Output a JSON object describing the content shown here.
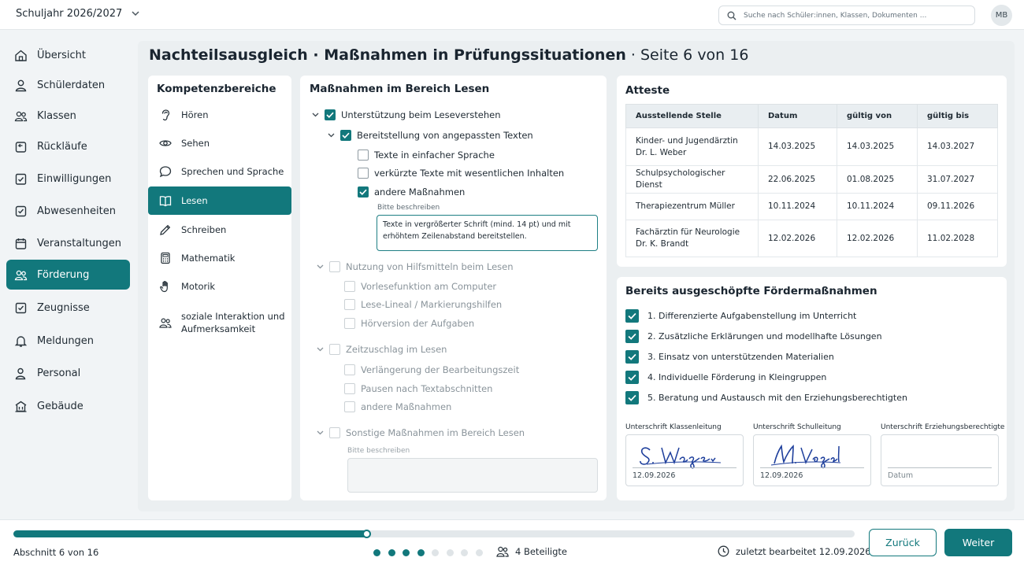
{
  "header": {
    "school_year": "Schuljahr 2026/2027",
    "search_placeholder": "Suche nach Schüler:innen, Klassen, Dokumenten ...",
    "avatar": "MB"
  },
  "sidebar": {
    "items": [
      {
        "label": "Übersicht",
        "icon": "home-icon"
      },
      {
        "label": "Schülerdaten",
        "icon": "user-icon"
      },
      {
        "label": "Klassen",
        "icon": "users-icon"
      },
      {
        "label": "Rückläufe",
        "icon": "return-icon"
      },
      {
        "label": "Einwilligungen",
        "icon": "consent-icon"
      },
      {
        "label": "Abwesenheiten",
        "icon": "absence-icon"
      },
      {
        "label": "Veranstaltungen",
        "icon": "calendar-icon"
      },
      {
        "label": "Förderung",
        "icon": "support-icon",
        "active": true
      },
      {
        "label": "Zeugnisse",
        "icon": "certificate-icon"
      },
      {
        "label": "Meldungen",
        "icon": "bell-icon"
      },
      {
        "label": "Personal",
        "icon": "staff-icon"
      },
      {
        "label": "Gebäude",
        "icon": "building-icon"
      }
    ]
  },
  "page": {
    "title": "Nachteilsausgleich · Maßnahmen in Prüfungssituationen",
    "page_info": " · Seite 6 von 16"
  },
  "competences": {
    "title": "Kompetenzbereiche",
    "items": [
      {
        "label": "Hören",
        "icon": "ear-icon"
      },
      {
        "label": "Sehen",
        "icon": "eye-icon"
      },
      {
        "label": "Sprechen und Sprache",
        "icon": "speech-icon"
      },
      {
        "label": "Lesen",
        "icon": "book-icon",
        "active": true
      },
      {
        "label": "Schreiben",
        "icon": "pencil-icon"
      },
      {
        "label": "Mathematik",
        "icon": "calculator-icon"
      },
      {
        "label": "Motorik",
        "icon": "hand-icon"
      },
      {
        "label": "soziale Interaktion und Aufmerksamkeit",
        "line1": "soziale Interaktion und",
        "line2": "Aufmerksamkeit",
        "icon": "group-icon"
      }
    ]
  },
  "measures": {
    "title": "Maßnahmen im Bereich Lesen",
    "group1": {
      "label": "Unterstützung beim Leseverstehen",
      "checked": true,
      "sub": {
        "label": "Bereitstellung von angepassten Texten",
        "checked": true,
        "options": [
          {
            "label": "Texte in einfacher Sprache",
            "checked": false
          },
          {
            "label": "verkürzte Texte mit wesentlichen Inhalten",
            "checked": false
          },
          {
            "label": "andere Maßnahmen",
            "checked": true
          }
        ],
        "describe_label": "Bitte beschreiben",
        "describe_value": "Texte in vergrößerter Schrift (mind. 14 pt) und mit erhöhtem Zeilenabstand bereitstellen."
      }
    },
    "group2": {
      "label": "Nutzung von Hilfsmitteln beim Lesen",
      "options": [
        "Vorlesefunktion am Computer",
        "Lese-Lineal / Markierungshilfen",
        "Hörversion der Aufgaben"
      ]
    },
    "group3": {
      "label": "Zeitzuschlag im Lesen",
      "options": [
        "Verlängerung der Bearbeitungszeit",
        "Pausen nach Textabschnitten",
        "andere Maßnahmen"
      ]
    },
    "group4": {
      "label": "Sonstige Maßnahmen im Bereich Lesen",
      "describe_label": "Bitte beschreiben",
      "describe_value": ""
    }
  },
  "attests": {
    "title": "Atteste",
    "columns": [
      "Ausstellende Stelle",
      "Datum",
      "gültig von",
      "gültig bis"
    ],
    "rows": [
      {
        "issuer1": "Kinder- und Jugendärztin",
        "issuer2": "Dr. L. Weber",
        "date": "14.03.2025",
        "from": "14.03.2025",
        "to": "14.03.2027"
      },
      {
        "issuer1": "Schulpsychologischer Dienst",
        "issuer2": "",
        "date": "22.06.2025",
        "from": "01.08.2025",
        "to": "31.07.2027"
      },
      {
        "issuer1": "Therapiezentrum Müller",
        "issuer2": "",
        "date": "10.11.2024",
        "from": "10.11.2024",
        "to": "09.11.2026"
      },
      {
        "issuer1": "Fachärztin für Neurologie",
        "issuer2": "Dr. K. Brandt",
        "date": "12.02.2026",
        "from": "12.02.2026",
        "to": "11.02.2028"
      }
    ]
  },
  "exhausted": {
    "title": "Bereits ausgeschöpfte Fördermaßnahmen",
    "items": [
      "1. Differenzierte Aufgabenstellung im Unterricht",
      "2. Zusätzliche Erklärungen und modellhafte Lösungen",
      "3. Einsatz von unterstützenden Materialien",
      "4. Individuelle Förderung in Kleingruppen",
      "5. Beratung und Austausch mit den Erziehungsberechtigten"
    ]
  },
  "signatures": {
    "teacher": {
      "label": "Unterschrift Klassenleitung",
      "name": "S. Wagner",
      "date": "12.09.2026"
    },
    "principal": {
      "label": "Unterschrift Schulleitung",
      "name": "M. Vogel",
      "date": "12.09.2026"
    },
    "guardian": {
      "label": "Unterschrift Erziehungsberechtigte",
      "date": "Datum"
    }
  },
  "footer": {
    "section": "Abschnitt 6 von 16",
    "progress": 0.42,
    "steps_completed": 4,
    "steps_shown": 8,
    "participants": "4 Beteiligte",
    "last_edited": "zuletzt bearbeitet 12.09.2026",
    "back": "Zurück",
    "next": "Weiter"
  },
  "colors": {
    "accent": "#12787c"
  }
}
